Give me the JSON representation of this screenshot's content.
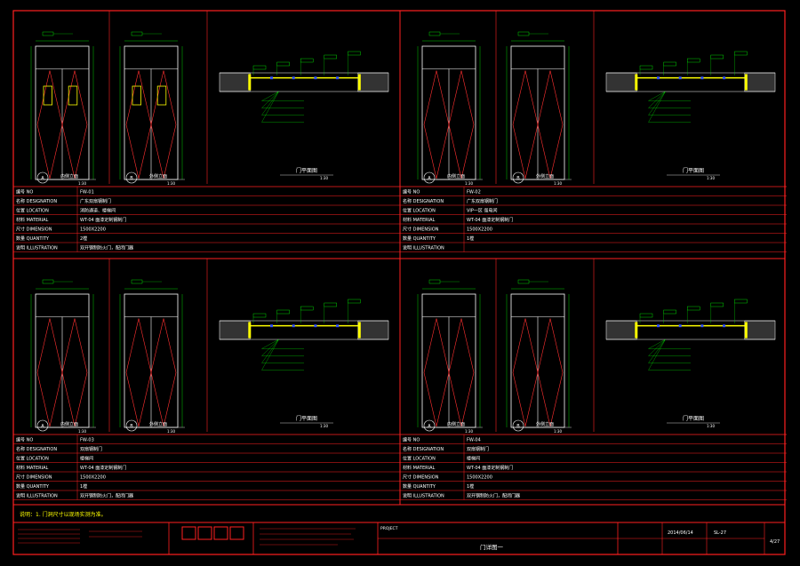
{
  "panels": [
    {
      "views": [
        "A",
        "B"
      ],
      "view_titles": [
        "内侧立面",
        "外侧立面"
      ],
      "plan_title": "门平面图",
      "rows": [
        {
          "label": "编号 NO",
          "value": "FW-01"
        },
        {
          "label": "名称 DESIGNATION",
          "value": "广东双扇钢制门"
        },
        {
          "label": "位置 LOCATION",
          "value": "消防通道、楼梯间"
        },
        {
          "label": "材料 MATERIAL",
          "value": "WT-04 面漆定制钢制门"
        },
        {
          "label": "尺寸 DIMENSION",
          "value": "1500X2200"
        },
        {
          "label": "数量 QUANTITY",
          "value": "2樘"
        },
        {
          "label": "说明 ILLUSTRATION",
          "value": "双开钢制防火门，配闭门器"
        }
      ]
    },
    {
      "views": [
        "A",
        "B"
      ],
      "view_titles": [
        "内侧立面",
        "外侧立面"
      ],
      "plan_title": "门平面图",
      "rows": [
        {
          "label": "编号 NO",
          "value": "FW-02"
        },
        {
          "label": "名称 DESIGNATION",
          "value": "广东双扇钢制门"
        },
        {
          "label": "位置 LOCATION",
          "value": "VIP一区 强电间"
        },
        {
          "label": "材料 MATERIAL",
          "value": "WT-04 面漆定制钢制门"
        },
        {
          "label": "尺寸 DIMENSION",
          "value": "1500X2200"
        },
        {
          "label": "数量 QUANTITY",
          "value": "1樘"
        },
        {
          "label": "说明 ILLUSTRATION",
          "value": ""
        }
      ]
    },
    {
      "views": [
        "A",
        "B"
      ],
      "view_titles": [
        "内侧立面",
        "外侧立面"
      ],
      "plan_title": "门平面图",
      "rows": [
        {
          "label": "编号 NO",
          "value": "FW-03"
        },
        {
          "label": "名称 DESIGNATION",
          "value": "双扇钢制门"
        },
        {
          "label": "位置 LOCATION",
          "value": "楼梯间"
        },
        {
          "label": "材料 MATERIAL",
          "value": "WT-04 面漆定制钢制门"
        },
        {
          "label": "尺寸 DIMENSION",
          "value": "1500X2200"
        },
        {
          "label": "数量 QUANTITY",
          "value": "1樘"
        },
        {
          "label": "说明 ILLUSTRATION",
          "value": "双开钢制防火门，配闭门器"
        }
      ]
    },
    {
      "views": [
        "A",
        "B"
      ],
      "view_titles": [
        "内侧立面",
        "外侧立面"
      ],
      "plan_title": "门平面图",
      "rows": [
        {
          "label": "编号 NO",
          "value": "FW-04"
        },
        {
          "label": "名称 DESIGNATION",
          "value": "双扇钢制门"
        },
        {
          "label": "位置 LOCATION",
          "value": "楼梯间"
        },
        {
          "label": "材料 MATERIAL",
          "value": "WT-04 面漆定制钢制门"
        },
        {
          "label": "尺寸 DIMENSION",
          "value": "1500X2200"
        },
        {
          "label": "数量 QUANTITY",
          "value": "1樘"
        },
        {
          "label": "说明 ILLUSTRATION",
          "value": "双开钢制防火门，配闭门器"
        }
      ]
    }
  ],
  "scale": "1:30",
  "note": "说明：1. 门洞尺寸以现场实测为准。",
  "title_block": {
    "project_label": "PROJECT",
    "project_name": "",
    "drawing_title": "门详图一",
    "date": "2014/06/14",
    "sheet_no": "SL-27",
    "page": "4/27",
    "designer": ""
  },
  "colors": {
    "frame": "#ff2020",
    "line": "#ffffff",
    "accent": "#ffff00",
    "dim": "#00ff00",
    "label": "#00ffff",
    "mark": "#ff3030"
  }
}
